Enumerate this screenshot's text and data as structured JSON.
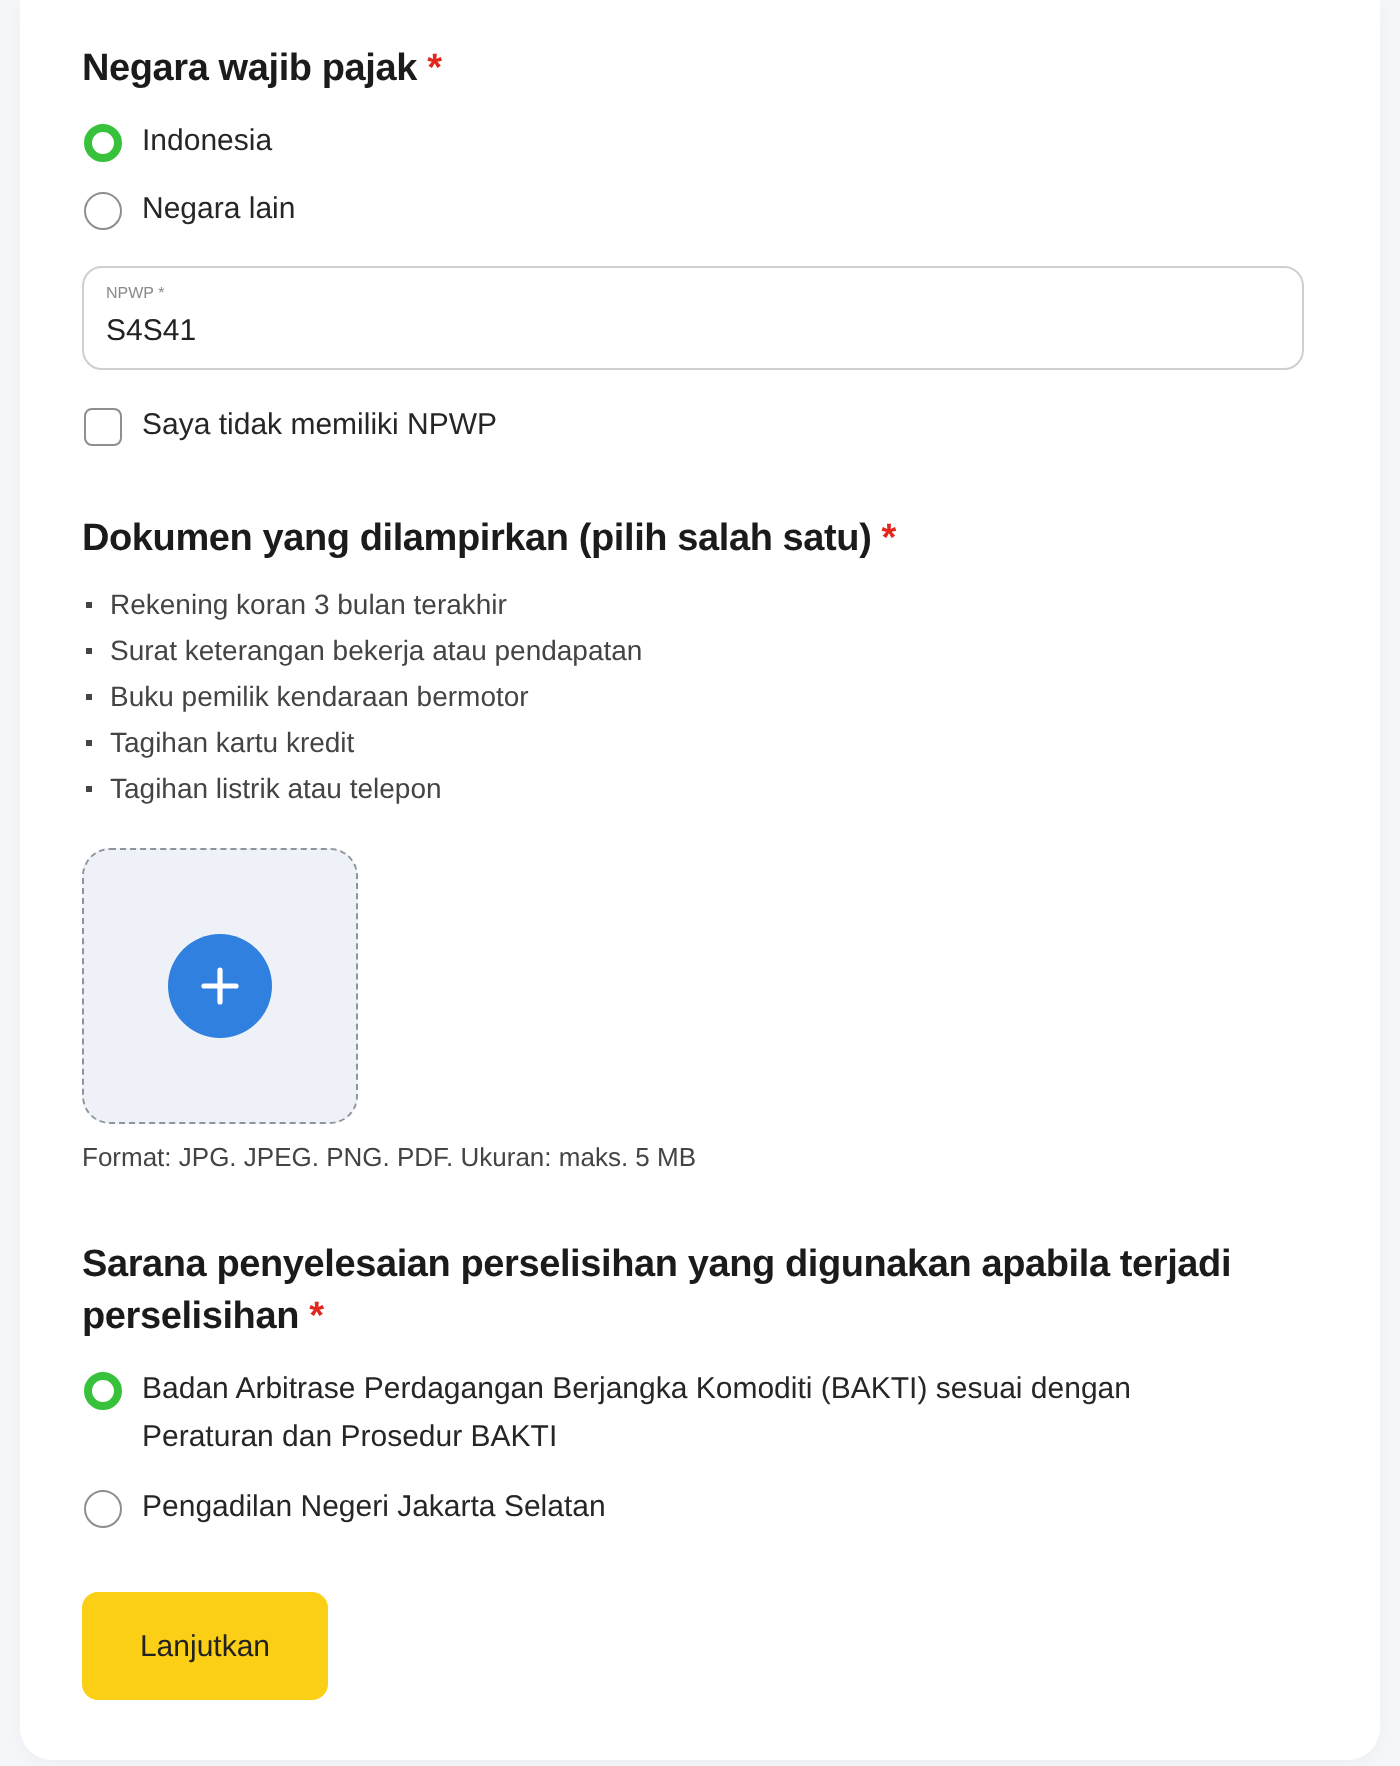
{
  "tax_country": {
    "title": "Negara wajib pajak",
    "required_mark": "*",
    "options": [
      {
        "label": "Indonesia",
        "selected": true
      },
      {
        "label": "Negara lain",
        "selected": false
      }
    ],
    "npwp_field": {
      "label": "NPWP *",
      "value": "S4S41"
    },
    "no_npwp": {
      "label": "Saya tidak memiliki NPWP",
      "checked": false
    }
  },
  "documents": {
    "title": "Dokumen yang dilampirkan (pilih salah satu)",
    "required_mark": "*",
    "items": [
      "Rekening koran 3 bulan terakhir",
      "Surat keterangan bekerja atau pendapatan",
      "Buku pemilik kendaraan bermotor",
      "Tagihan kartu kredit",
      "Tagihan listrik atau telepon"
    ],
    "upload_note": "Format: JPG. JPEG. PNG. PDF. Ukuran: maks. 5 MB"
  },
  "dispute_resolution": {
    "title": "Sarana penyelesaian perselisihan yang digunakan apabila terjadi perselisihan",
    "required_mark": "*",
    "options": [
      {
        "label": "Badan Arbitrase Perdagangan Berjangka Komoditi (BAKTI) sesuai dengan Peraturan dan Prosedur BAKTI",
        "selected": true
      },
      {
        "label": "Pengadilan Negeri Jakarta Selatan",
        "selected": false
      }
    ]
  },
  "continue_button": "Lanjutkan"
}
